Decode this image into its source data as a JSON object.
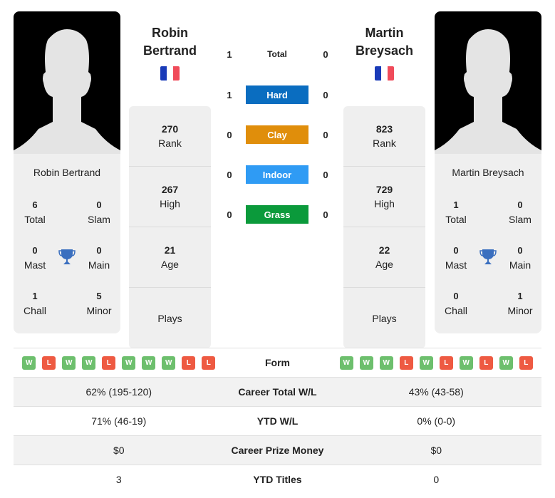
{
  "colors": {
    "win": "#6dbf6d",
    "loss": "#ee5a42",
    "hard": "#0a6dc0",
    "clay": "#e08e0b",
    "indoor": "#2f9bf4",
    "grass": "#0b9a3b",
    "trophy": "#3a6fbf",
    "flag_blue": "#1a3bb8",
    "flag_red": "#f04b5a"
  },
  "player1": {
    "name_line1": "Robin",
    "name_line2": "Bertrand",
    "card_name": "Robin Bertrand",
    "country_flag": "france-flag",
    "titles": {
      "total": {
        "value": "6",
        "label": "Total"
      },
      "slam": {
        "value": "0",
        "label": "Slam"
      },
      "mast": {
        "value": "0",
        "label": "Mast"
      },
      "main": {
        "value": "0",
        "label": "Main"
      },
      "chall": {
        "value": "1",
        "label": "Chall"
      },
      "minor": {
        "value": "5",
        "label": "Minor"
      }
    },
    "stats": [
      {
        "value": "270",
        "label": "Rank"
      },
      {
        "value": "267",
        "label": "High"
      },
      {
        "value": "21",
        "label": "Age"
      },
      {
        "value": "",
        "label": "Plays"
      }
    ],
    "form": [
      "W",
      "L",
      "W",
      "W",
      "L",
      "W",
      "W",
      "W",
      "L",
      "L"
    ]
  },
  "player2": {
    "name_line1": "Martin",
    "name_line2": "Breysach",
    "card_name": "Martin Breysach",
    "country_flag": "france-flag",
    "titles": {
      "total": {
        "value": "1",
        "label": "Total"
      },
      "slam": {
        "value": "0",
        "label": "Slam"
      },
      "mast": {
        "value": "0",
        "label": "Mast"
      },
      "main": {
        "value": "0",
        "label": "Main"
      },
      "chall": {
        "value": "0",
        "label": "Chall"
      },
      "minor": {
        "value": "1",
        "label": "Minor"
      }
    },
    "stats": [
      {
        "value": "823",
        "label": "Rank"
      },
      {
        "value": "729",
        "label": "High"
      },
      {
        "value": "22",
        "label": "Age"
      },
      {
        "value": "",
        "label": "Plays"
      }
    ],
    "form": [
      "W",
      "W",
      "W",
      "L",
      "W",
      "L",
      "W",
      "L",
      "W",
      "L"
    ]
  },
  "h2h": [
    {
      "label": "Total",
      "p1": "1",
      "p2": "0",
      "surface": "total"
    },
    {
      "label": "Hard",
      "p1": "1",
      "p2": "0",
      "surface": "hard"
    },
    {
      "label": "Clay",
      "p1": "0",
      "p2": "0",
      "surface": "clay"
    },
    {
      "label": "Indoor",
      "p1": "0",
      "p2": "0",
      "surface": "indoor"
    },
    {
      "label": "Grass",
      "p1": "0",
      "p2": "0",
      "surface": "grass"
    }
  ],
  "comparison": {
    "form_label": "Form",
    "rows": [
      {
        "label": "Career Total W/L",
        "p1": "62% (195-120)",
        "p2": "43% (43-58)"
      },
      {
        "label": "YTD W/L",
        "p1": "71% (46-19)",
        "p2": "0% (0-0)"
      },
      {
        "label": "Career Prize Money",
        "p1": "$0",
        "p2": "$0"
      },
      {
        "label": "YTD Titles",
        "p1": "3",
        "p2": "0"
      }
    ]
  }
}
